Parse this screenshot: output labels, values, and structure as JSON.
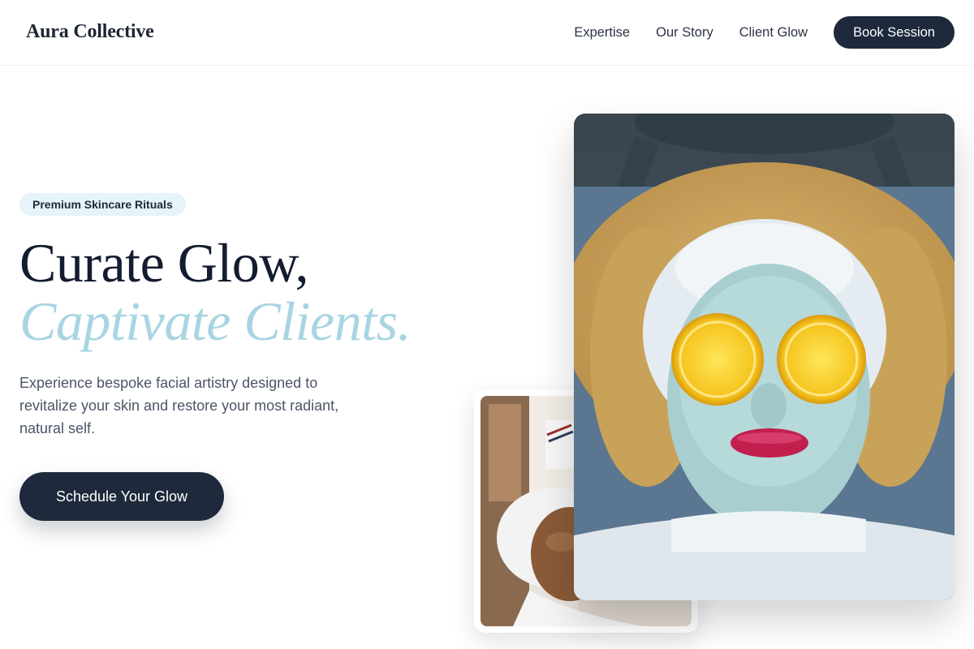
{
  "brand": {
    "name": "Aura Collective"
  },
  "nav": {
    "links": [
      "Expertise",
      "Our Story",
      "Client Glow"
    ],
    "cta": "Book Session"
  },
  "hero": {
    "badge": "Premium Skincare Rituals",
    "headline_line1": "Curate Glow,",
    "headline_line2": "Captivate Clients.",
    "description": "Experience bespoke facial artistry designed to revitalize your skin and restore your most radiant, natural self.",
    "cta": "Schedule Your Glow"
  },
  "images": {
    "main": {
      "subject": "woman with clay face mask and lemon slices on eyes"
    },
    "secondary": {
      "subject": "client receiving facial treatment with head wrap"
    }
  },
  "colors": {
    "primary": "#1e293b",
    "accent": "#a8d5e2",
    "badge_bg": "#e6f3f8",
    "text_muted": "#4b5568"
  }
}
